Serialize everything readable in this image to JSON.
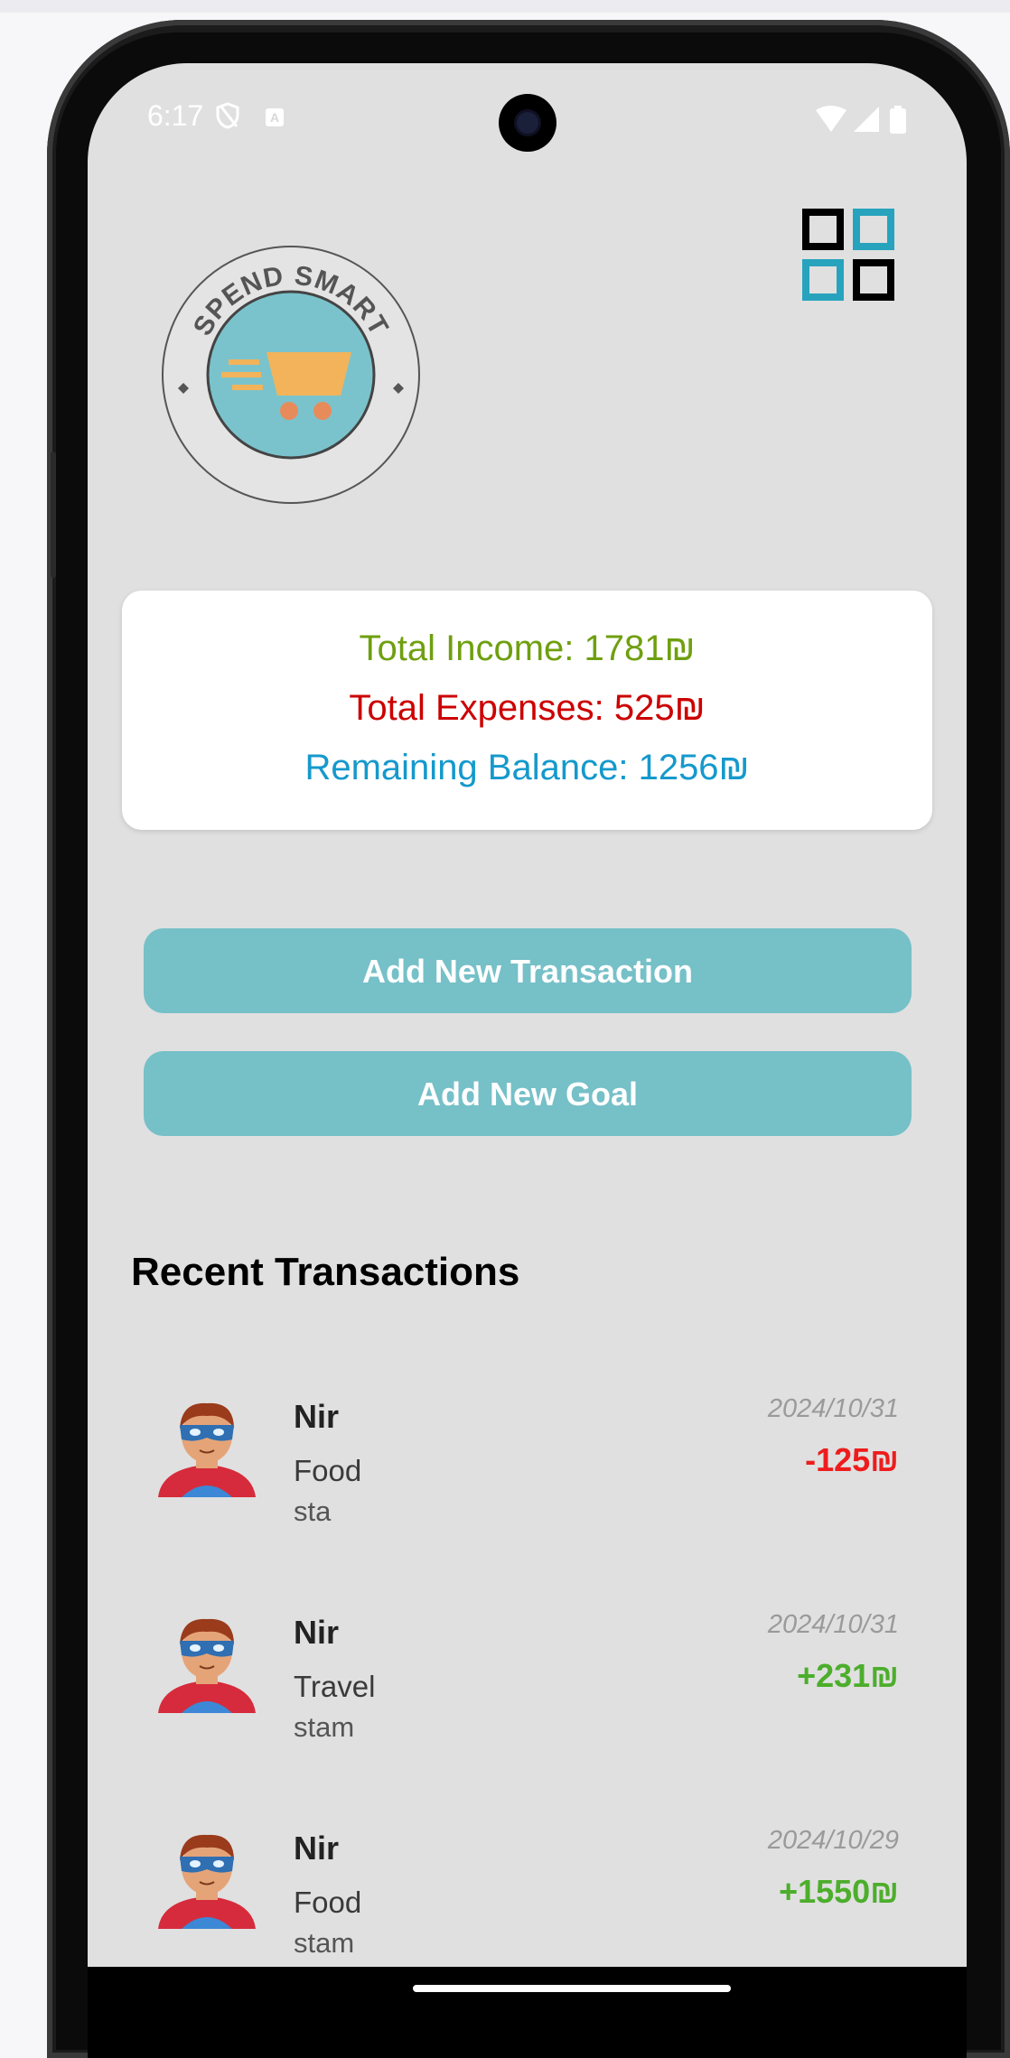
{
  "status_bar": {
    "time": "6:17",
    "icons": [
      "shield-icon",
      "notification-a-icon",
      "wifi-icon",
      "signal-icon",
      "battery-icon"
    ]
  },
  "app": {
    "logo_text": "SPEND SMART",
    "menu_icon": "grid-menu-icon"
  },
  "summary": {
    "income": "Total Income: 1781₪",
    "expenses": "Total Expenses: 525₪",
    "balance": "Remaining Balance: 1256₪"
  },
  "actions": {
    "add_transaction": "Add New Transaction",
    "add_goal": "Add New Goal"
  },
  "recent": {
    "title": "Recent Transactions",
    "items": [
      {
        "name": "Nir",
        "category": "Food",
        "description": "sta",
        "date": "2024/10/31",
        "amount": "-125₪",
        "type": "expense"
      },
      {
        "name": "Nir",
        "category": "Travel",
        "description": "stam",
        "date": "2024/10/31",
        "amount": "+231₪",
        "type": "income"
      },
      {
        "name": "Nir",
        "category": "Food",
        "description": "stam",
        "date": "2024/10/29",
        "amount": "+1550₪",
        "type": "income"
      }
    ]
  },
  "colors": {
    "income": "#6f9f0f",
    "expense": "#cc0000",
    "balance": "#1599cc",
    "button": "#76c0c8",
    "background": "#e0e0e0"
  }
}
